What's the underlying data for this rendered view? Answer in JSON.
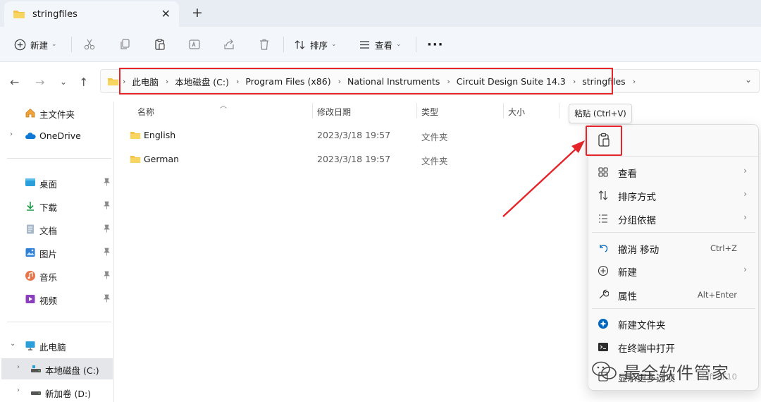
{
  "tab": {
    "title": "stringfiles"
  },
  "toolbar": {
    "new_label": "新建",
    "sort_label": "排序",
    "view_label": "查看",
    "more_label": "···"
  },
  "address": {
    "crumbs": [
      "此电脑",
      "本地磁盘 (C:)",
      "Program Files (x86)",
      "National Instruments",
      "Circuit Design Suite 14.3",
      "stringfiles"
    ]
  },
  "sidebar": {
    "items": [
      {
        "label": "主文件夹",
        "icon": "home-icon"
      },
      {
        "label": "OneDrive",
        "icon": "cloud-icon"
      },
      {
        "label": "桌面",
        "icon": "desktop-icon",
        "pinned": true
      },
      {
        "label": "下载",
        "icon": "download-icon",
        "pinned": true
      },
      {
        "label": "文档",
        "icon": "document-icon",
        "pinned": true
      },
      {
        "label": "图片",
        "icon": "picture-icon",
        "pinned": true
      },
      {
        "label": "音乐",
        "icon": "music-icon",
        "pinned": true
      },
      {
        "label": "视频",
        "icon": "video-icon",
        "pinned": true
      },
      {
        "label": "此电脑",
        "icon": "pc-icon"
      },
      {
        "label": "本地磁盘 (C:)",
        "icon": "drive-icon",
        "selected": true
      },
      {
        "label": "新加卷 (D:)",
        "icon": "drive-icon"
      }
    ]
  },
  "columns": {
    "name": "名称",
    "modified": "修改日期",
    "type": "类型",
    "size": "大小"
  },
  "files": [
    {
      "name": "English",
      "modified": "2023/3/18 19:57",
      "type": "文件夹"
    },
    {
      "name": "German",
      "modified": "2023/3/18 19:57",
      "type": "文件夹"
    }
  ],
  "tooltip": {
    "text": "粘贴 (Ctrl+V)"
  },
  "context_menu": {
    "items": [
      {
        "label": "查看",
        "icon": "grid-icon",
        "submenu": true
      },
      {
        "label": "排序方式",
        "icon": "sort-icon",
        "submenu": true
      },
      {
        "label": "分组依据",
        "icon": "group-icon",
        "submenu": true
      },
      {
        "label": "撤消 移动",
        "icon": "undo-icon",
        "shortcut": "Ctrl+Z"
      },
      {
        "label": "新建",
        "icon": "plus-circle-icon",
        "submenu": true
      },
      {
        "label": "属性",
        "icon": "wrench-icon",
        "shortcut": "Alt+Enter"
      },
      {
        "label": "新建文件夹",
        "icon": "new-folder-icon"
      },
      {
        "label": "在终端中打开",
        "icon": "terminal-icon"
      },
      {
        "label": "显示更多选项",
        "icon": "more-options-icon",
        "shortcut": "Shift+F10"
      }
    ]
  },
  "watermark": {
    "text": "最全软件管家"
  },
  "colors": {
    "accent": "#0067c0",
    "folder": "#f4c244",
    "annotation_red": "#e5252a"
  }
}
